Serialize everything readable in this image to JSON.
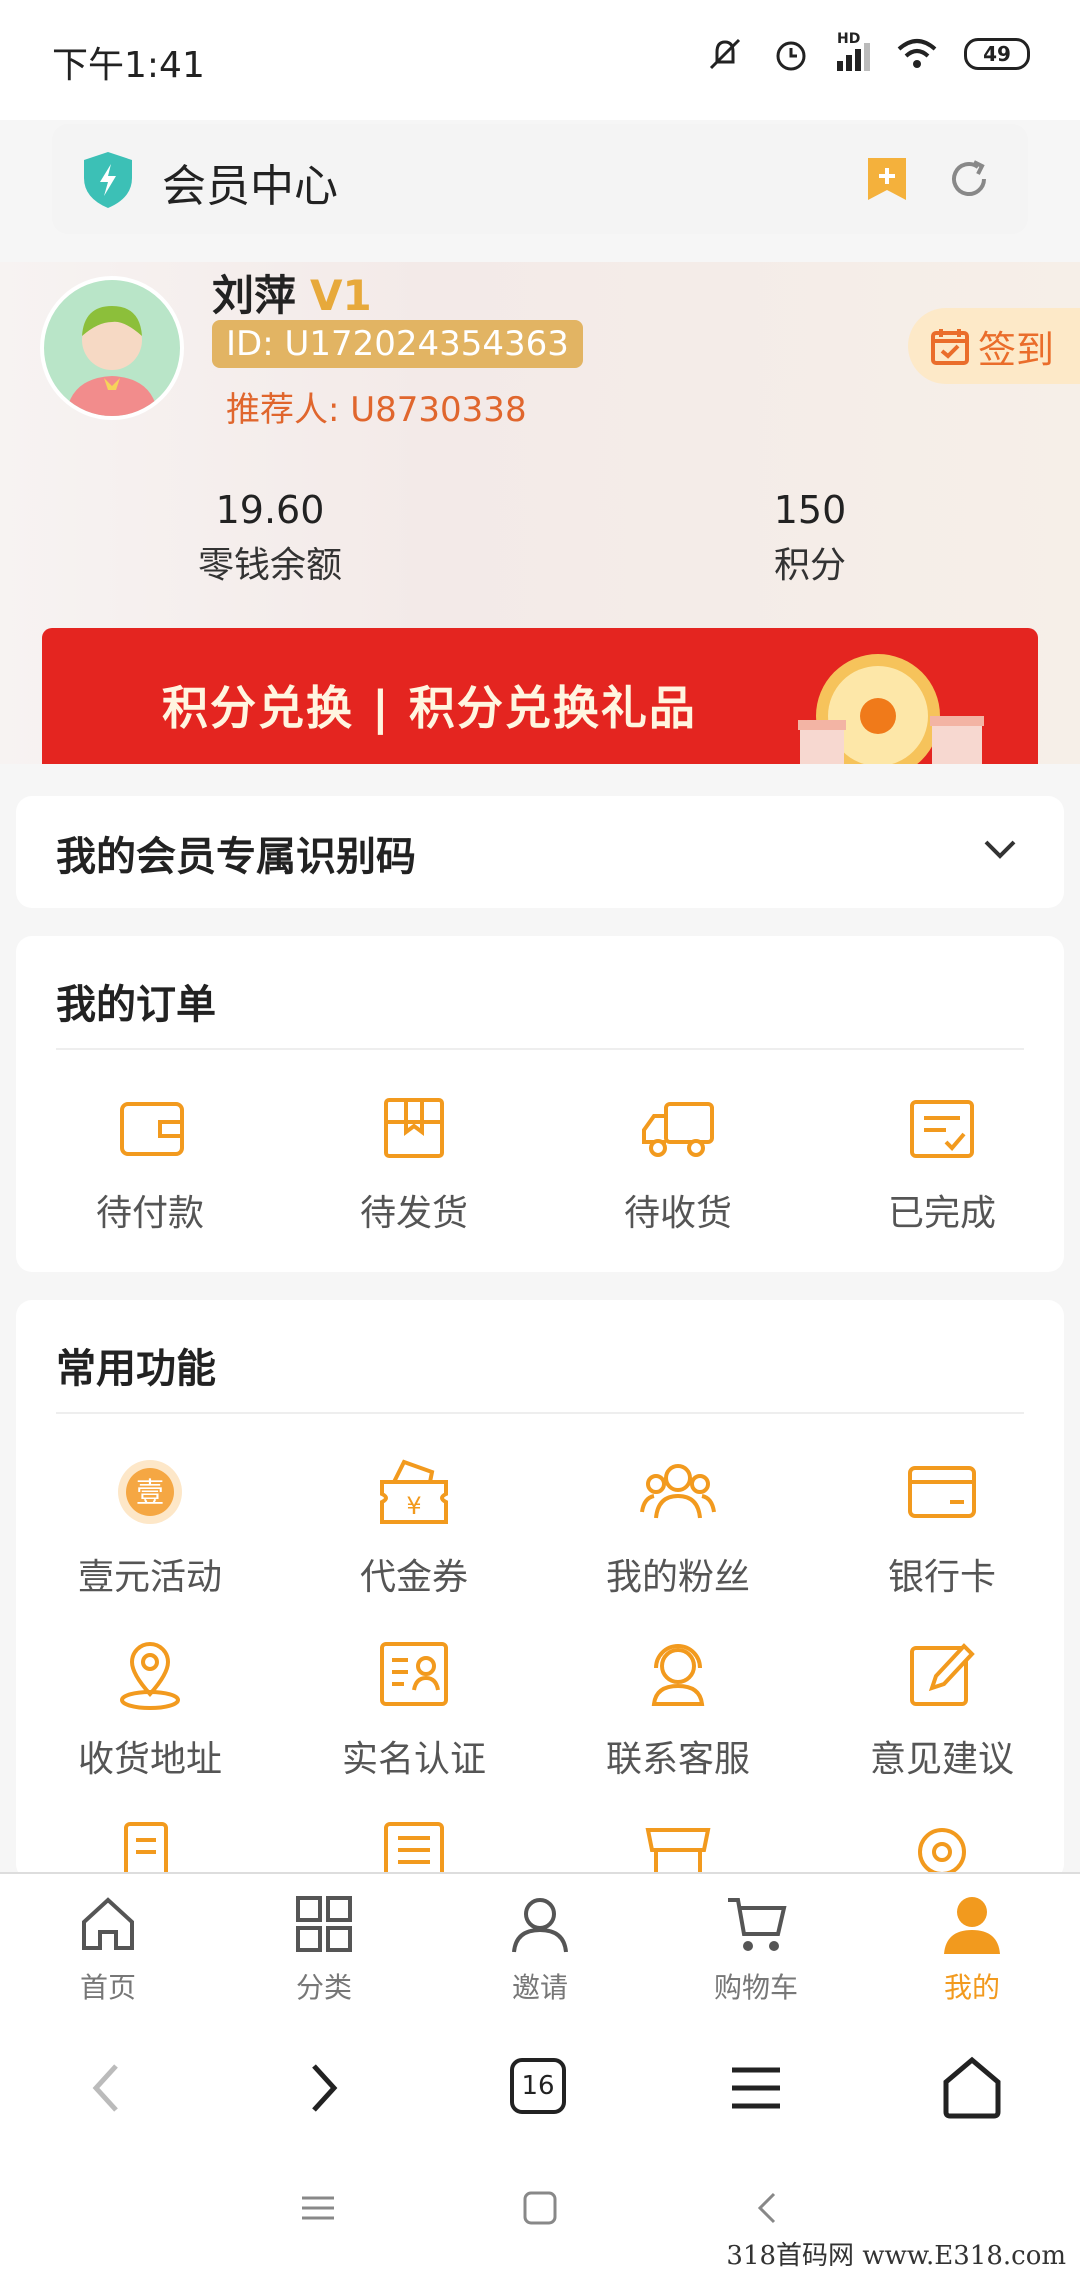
{
  "status_bar": {
    "time": "下午1:41",
    "battery": "49",
    "network": "HD"
  },
  "browser": {
    "page_title": "会员中心",
    "tab_count": "16"
  },
  "user": {
    "name": "刘萍",
    "level": "V1",
    "id_label": "ID: U172024354363",
    "referrer": "推荐人: U8730338",
    "checkin_label": "签到"
  },
  "stats": [
    {
      "value": "19.60",
      "label": "零钱余额"
    },
    {
      "value": "150",
      "label": "积分"
    }
  ],
  "banner": {
    "text": "积分兑换 | 积分兑换礼品"
  },
  "member_code": {
    "title": "我的会员专属识别码"
  },
  "orders": {
    "title": "我的订单",
    "items": [
      {
        "label": "待付款",
        "icon": "wallet-icon"
      },
      {
        "label": "待发货",
        "icon": "package-icon"
      },
      {
        "label": "待收货",
        "icon": "truck-icon"
      },
      {
        "label": "已完成",
        "icon": "completed-icon"
      }
    ]
  },
  "features": {
    "title": "常用功能",
    "items": [
      {
        "label": "壹元活动",
        "icon": "one-yuan-icon"
      },
      {
        "label": "代金券",
        "icon": "voucher-icon"
      },
      {
        "label": "我的粉丝",
        "icon": "fans-icon"
      },
      {
        "label": "银行卡",
        "icon": "bank-card-icon"
      },
      {
        "label": "收货地址",
        "icon": "location-icon"
      },
      {
        "label": "实名认证",
        "icon": "id-card-icon"
      },
      {
        "label": "联系客服",
        "icon": "customer-service-icon"
      },
      {
        "label": "意见建议",
        "icon": "feedback-icon"
      }
    ]
  },
  "tabbar": {
    "items": [
      {
        "label": "首页",
        "icon": "home-icon"
      },
      {
        "label": "分类",
        "icon": "category-icon"
      },
      {
        "label": "邀请",
        "icon": "invite-icon"
      },
      {
        "label": "购物车",
        "icon": "cart-icon"
      },
      {
        "label": "我的",
        "icon": "profile-icon",
        "active": true
      }
    ]
  },
  "colors": {
    "accent": "#f29a1e",
    "banner": "#e42520",
    "id_badge": "#e2b463"
  },
  "watermark": "318首码网 www.E318.com"
}
